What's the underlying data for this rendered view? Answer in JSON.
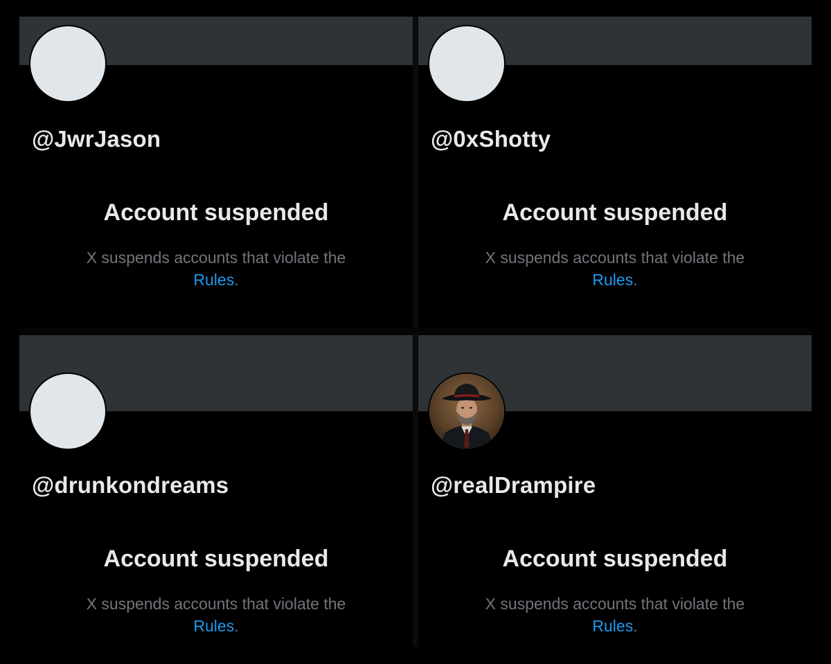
{
  "accounts": [
    {
      "handle": "@JwrJason",
      "status_title": "Account suspended",
      "status_text": "X suspends accounts that violate the",
      "rules_link": "Rules",
      "period": ".",
      "avatar": "default-avatar"
    },
    {
      "handle": "@0xShotty",
      "status_title": "Account suspended",
      "status_text": "X suspends accounts that violate the",
      "rules_link": "Rules",
      "period": ".",
      "avatar": "default-avatar"
    },
    {
      "handle": "@drunkondreams",
      "status_title": "Account suspended",
      "status_text": "X suspends accounts that violate the",
      "rules_link": "Rules",
      "period": ".",
      "avatar": "default-avatar"
    },
    {
      "handle": "@realDrampire",
      "status_title": "Account suspended",
      "status_text": "X suspends accounts that violate the",
      "rules_link": "Rules",
      "period": ".",
      "avatar": "photo-cowboy-hat-man"
    }
  ],
  "colors": {
    "background": "#000000",
    "banner": "#2f3336",
    "avatar_placeholder": "#e1e6ea",
    "primary_text": "#e7e9ea",
    "secondary_text": "#71767b",
    "link": "#1d9bf0"
  }
}
